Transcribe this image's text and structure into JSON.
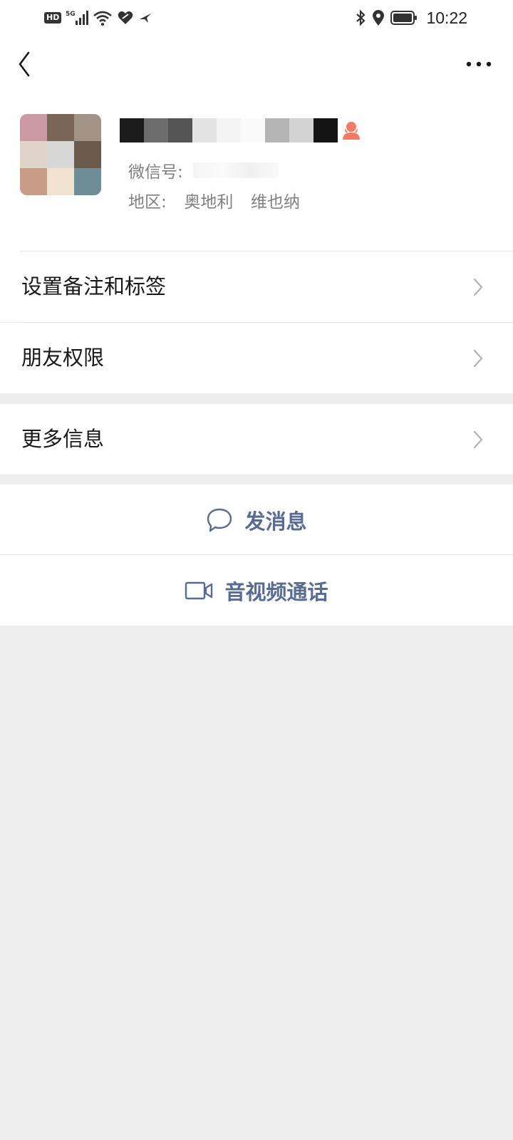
{
  "status_bar": {
    "hd": "HD",
    "network": "5G",
    "time": "10:22"
  },
  "nav": {
    "back_icon": "chevron-left-icon",
    "more_icon": "more-horizontal-icon"
  },
  "profile": {
    "wechat_id_label": "微信号:",
    "region_label": "地区:",
    "region_country": "奥地利",
    "region_city": "维也纳",
    "gender_icon": "female-user-icon",
    "gender_color": "#f37b63"
  },
  "menu": {
    "remark_tags": "设置备注和标签",
    "friend_permissions": "朋友权限",
    "more_info": "更多信息"
  },
  "actions": {
    "send_message": "发消息",
    "video_call": "音视频通话",
    "accent_color": "#576b95"
  }
}
